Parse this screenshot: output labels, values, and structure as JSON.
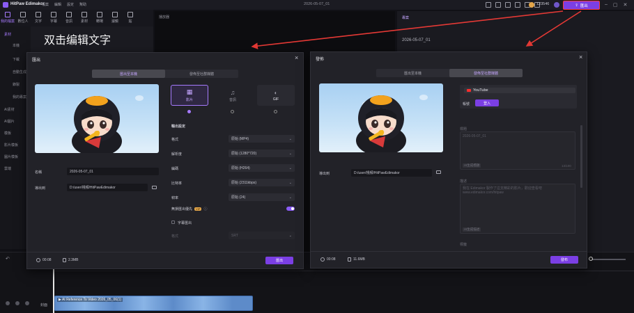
{
  "app": {
    "title": "HitPaw Edimakor",
    "menus": [
      "檔案",
      "編輯",
      "設定",
      "幫助"
    ],
    "document_title": "2026-05-07_01",
    "credits": "123546",
    "export_button": "匯出"
  },
  "toolbar": {
    "tools": [
      "我的檔案",
      "數位人",
      "文字",
      "字幕",
      "音訊",
      "素材",
      "轉場",
      "濾鏡",
      "貼"
    ]
  },
  "sidebar": {
    "items": [
      "素材",
      "本機",
      "下載",
      "自動生成",
      "錄製",
      "我的專案",
      "AI素材",
      "AI圖片",
      "模板",
      "影片模板",
      "圖片模板",
      "雲端"
    ]
  },
  "library": {
    "overlay_text": "双击编辑文字"
  },
  "preview": {
    "header": "播放器"
  },
  "properties": {
    "tab": "專案",
    "date": "2026-05-07_01"
  },
  "timeline": {
    "track_label": "封面",
    "clip_label": "▶ AI Reference To Video 2026_05_06(1)"
  },
  "export_dialog": {
    "title": "匯出",
    "tabs": [
      "匯出至本機",
      "發佈至社群媒體"
    ],
    "formats": [
      {
        "label": "影片",
        "icon": "film-icon"
      },
      {
        "label": "音訊",
        "icon": "music-note-icon"
      },
      {
        "label": "GIF",
        "icon": "gif-icon"
      }
    ],
    "name_label": "名稱",
    "name_value": "2026-05-07_01",
    "export_to_label": "導出到",
    "export_to_value": "D:/user/視頻/HitPawEdimakor",
    "settings_header": "輸出設定",
    "settings": [
      {
        "label": "格式",
        "value": "原始 (MP4)"
      },
      {
        "label": "解析度",
        "value": "原始 (1280*720)"
      },
      {
        "label": "編碼",
        "value": "原始 (H264)"
      },
      {
        "label": "比特率",
        "value": "原始 (2311kbps)"
      },
      {
        "label": "幀率",
        "value": "原始 (24)"
      }
    ],
    "lossless_label": "無損匯出優先",
    "vip": "VIP",
    "subtitle_export_label": "字幕匯出",
    "subtitle_format_label": "格式",
    "subtitle_format_value": "SRT",
    "duration": "00:08",
    "size": "2.3MB",
    "export_button": "匯出"
  },
  "publish_dialog": {
    "title": "發佈",
    "tabs": [
      "匯出至本機",
      "發佈至社群媒體"
    ],
    "platform": "YouTube",
    "account_label": "帳號",
    "login_button": "登入",
    "title_label": "標題",
    "title_value": "2026-05-07_01",
    "title_chip": "AI生成標題",
    "title_counter": "13/100",
    "desc_label": "描述",
    "desc_value": "我在 Edimakor 製作了這支精彩的影片，歡迎查看吧 www.edimakor.com/hitpaw",
    "desc_chip": "AI生成描述",
    "tags_label": "標籤",
    "export_to_label": "導出到",
    "export_to_value": "D:/user/視頻/HitPawEdimakor",
    "duration": "00:08",
    "size": "11.6MB",
    "publish_button": "發布"
  },
  "colors": {
    "accent": "#7b3fe4",
    "highlight_box": "#ff3b3b",
    "arrow": "#e53935"
  }
}
